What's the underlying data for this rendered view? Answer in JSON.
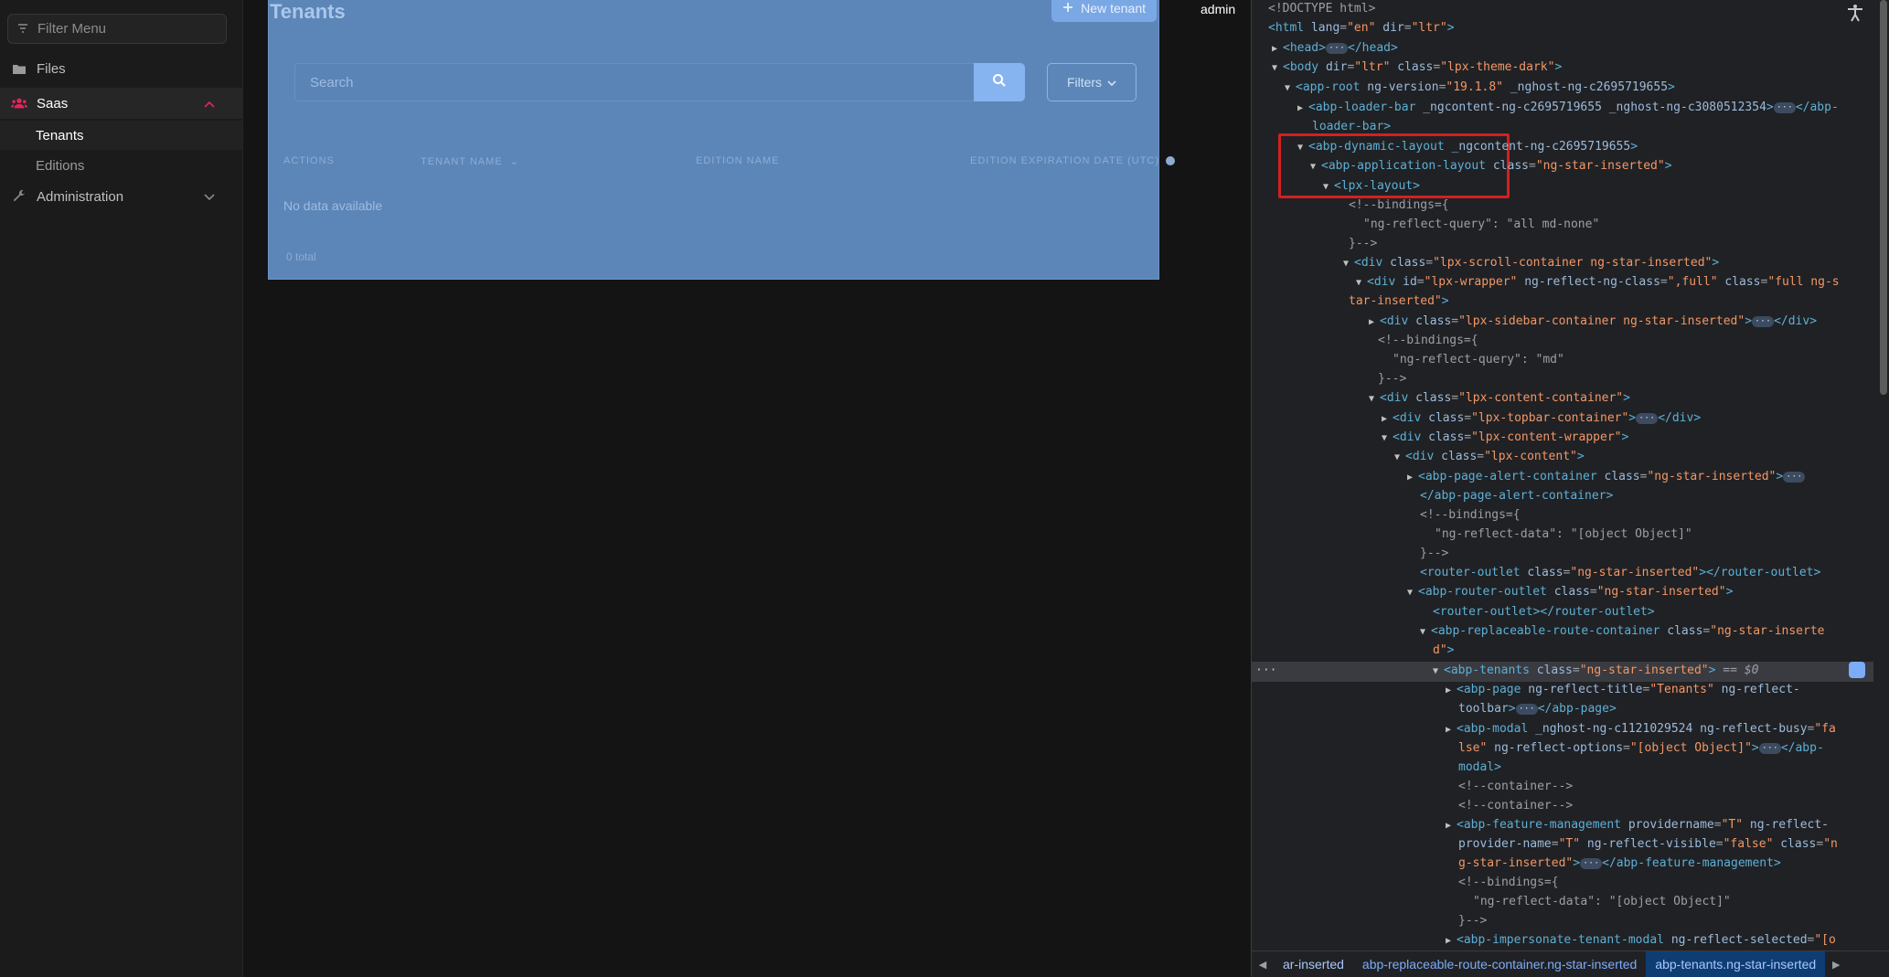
{
  "sidebar": {
    "filter_placeholder": "Filter Menu",
    "items": [
      {
        "label": "Files",
        "icon": "folder-icon"
      },
      {
        "label": "Saas",
        "icon": "users-icon"
      },
      {
        "label": "Administration",
        "icon": "wrench-icon"
      }
    ],
    "saas_children": [
      {
        "label": "Tenants"
      },
      {
        "label": "Editions"
      }
    ]
  },
  "page": {
    "title": "Tenants",
    "new_button": "New tenant",
    "search_placeholder": "Search",
    "filters_button": "Filters",
    "columns": [
      "Actions",
      "Tenant name",
      "Edition name",
      "Edition expiration date (UTC)"
    ],
    "empty_text": "No data available",
    "total_text": "0 total"
  },
  "topbar": {
    "user": "admin"
  },
  "devtools": {
    "selected_suffix": "== $0",
    "breadcrumbs": [
      "ar-inserted",
      "abp-replaceable-route-container.ng-star-inserted",
      "abp-tenants.ng-star-inserted"
    ]
  },
  "colors": {
    "accent": "#e5245a",
    "overlay": "#5c86b8",
    "highlight": "#d32020"
  }
}
